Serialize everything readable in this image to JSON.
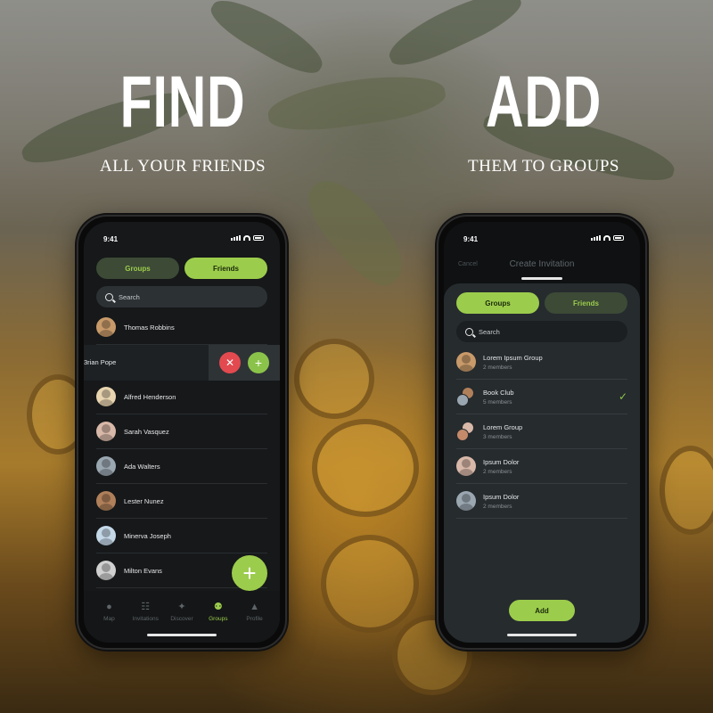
{
  "left": {
    "headline": "FIND",
    "subheadline": "ALL YOUR FRIENDS",
    "status_time": "9:41",
    "segments": [
      {
        "label": "Groups",
        "active": false
      },
      {
        "label": "Friends",
        "active": true
      }
    ],
    "search_placeholder": "Search",
    "contacts": [
      {
        "name": "Thomas Robbins",
        "avatar_color": "#c89a6a"
      },
      {
        "name": "Alfred Henderson",
        "avatar_color": "#e8d5b0"
      },
      {
        "name": "Sarah Vasquez",
        "avatar_color": "#d8b8a8"
      },
      {
        "name": "Ada Walters",
        "avatar_color": "#9aa6b0"
      },
      {
        "name": "Lester Nunez",
        "avatar_color": "#b0805a"
      },
      {
        "name": "Minerva Joseph",
        "avatar_color": "#c4d8e8"
      },
      {
        "name": "Milton Evans",
        "avatar_color": "#d0d0d0"
      }
    ],
    "swipe_contact": {
      "name": "Brian Pope",
      "visible_name": "3rian Pope",
      "decline_icon": "close-icon",
      "accept_icon": "plus-icon"
    },
    "fab_icon": "plus-icon",
    "tabs": [
      {
        "label": "Map",
        "icon": "map-pin-icon",
        "glyph": "●",
        "active": false
      },
      {
        "label": "Invitations",
        "icon": "table-icon",
        "glyph": "☷",
        "active": false
      },
      {
        "label": "Discover",
        "icon": "telescope-icon",
        "glyph": "✦",
        "active": false
      },
      {
        "label": "Groups",
        "icon": "people-icon",
        "glyph": "⚉",
        "active": true
      },
      {
        "label": "Profile",
        "icon": "person-icon",
        "glyph": "▲",
        "active": false
      }
    ]
  },
  "right": {
    "headline": "ADD",
    "subheadline": "THEM TO GROUPS",
    "status_time": "9:41",
    "cancel_label": "Cancel",
    "title": "Create Invitation",
    "segments": [
      {
        "label": "Groups",
        "active": true
      },
      {
        "label": "Friends",
        "active": false
      }
    ],
    "search_placeholder": "Search",
    "groups": [
      {
        "name": "Lorem Ipsum Group",
        "members": "2 members",
        "selected": false,
        "colors": [
          "#c89a6a",
          "#e8d5b0"
        ]
      },
      {
        "name": "Book Club",
        "members": "5 members",
        "selected": true,
        "colors": [
          "#b0805a",
          "#9aa6b0"
        ]
      },
      {
        "name": "Lorem Group",
        "members": "3 members",
        "selected": false,
        "colors": [
          "#d8b8a8",
          "#c48a6a"
        ]
      },
      {
        "name": "Ipsum Dolor",
        "members": "2 members",
        "selected": false,
        "colors": [
          "#d8b8a8",
          "#b0a090"
        ]
      },
      {
        "name": "Ipsum Dolor",
        "members": "2 members",
        "selected": false,
        "colors": [
          "#9aa6b0",
          "#c4d8e8"
        ]
      }
    ],
    "add_label": "Add",
    "check_glyph": "✓"
  },
  "colors": {
    "accent": "#9ccc4c",
    "danger": "#e24a4f",
    "dark_bg": "#161819"
  }
}
